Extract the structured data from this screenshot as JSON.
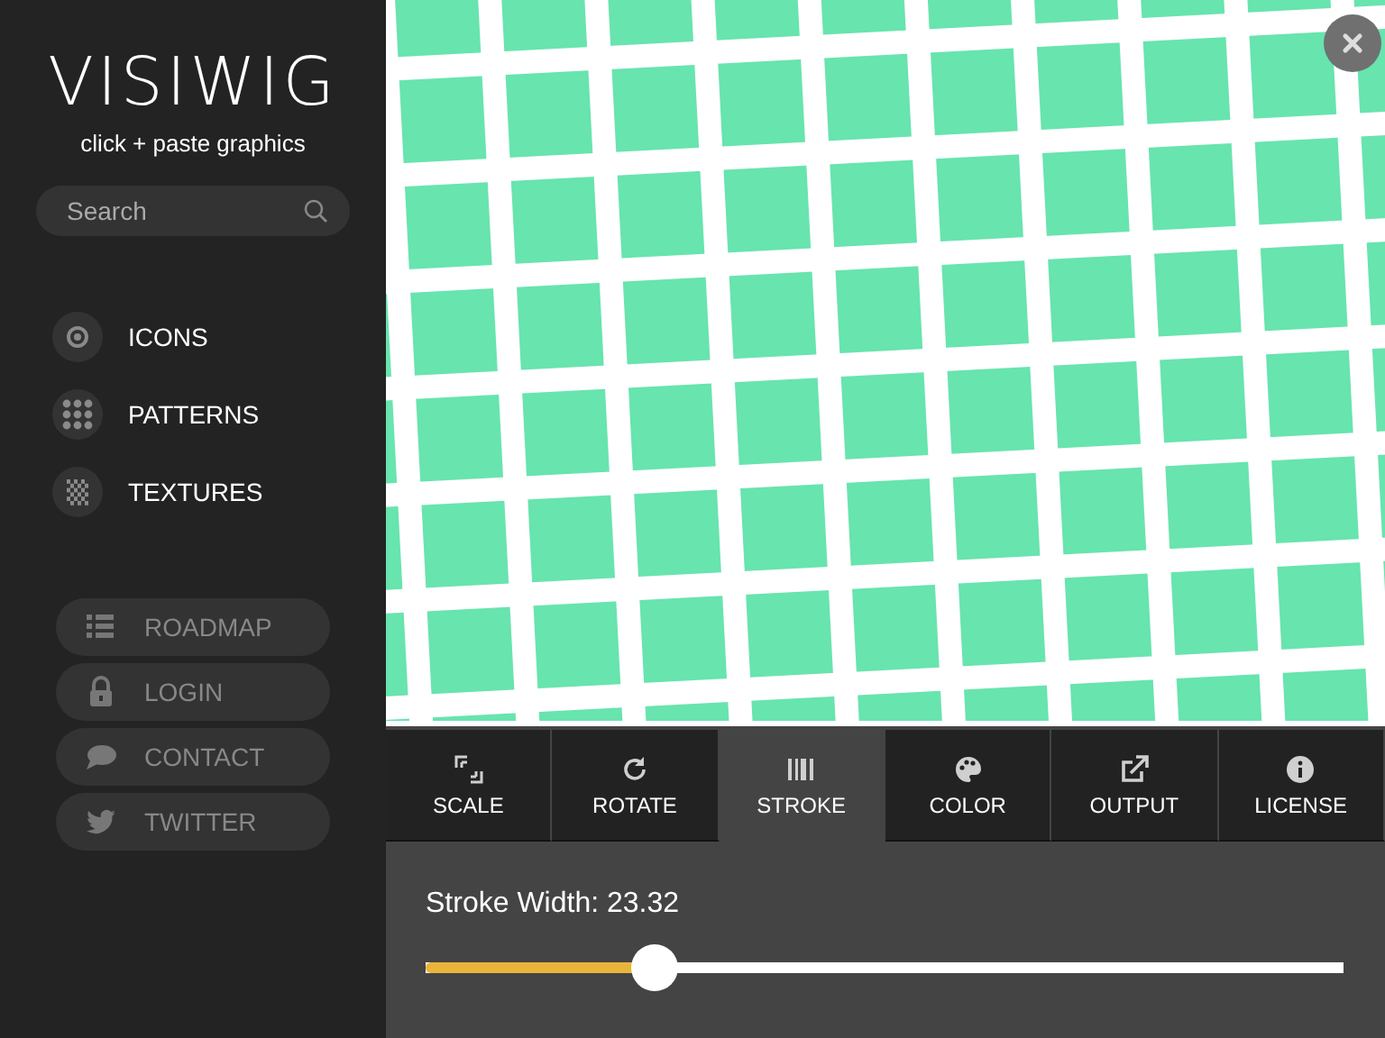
{
  "sidebar": {
    "logo": "VISIWIG",
    "tagline": "click + paste graphics",
    "search": {
      "placeholder": "Search"
    },
    "categories": [
      {
        "label": "ICONS",
        "kind": "icons"
      },
      {
        "label": "PATTERNS",
        "kind": "patterns"
      },
      {
        "label": "TEXTURES",
        "kind": "textures"
      }
    ],
    "links": [
      {
        "label": "ROADMAP",
        "kind": "roadmap"
      },
      {
        "label": "LOGIN",
        "kind": "login"
      },
      {
        "label": "CONTACT",
        "kind": "contact"
      },
      {
        "label": "TWITTER",
        "kind": "twitter"
      }
    ]
  },
  "tabs": [
    {
      "label": "SCALE",
      "kind": "scale",
      "selected": false
    },
    {
      "label": "ROTATE",
      "kind": "rotate",
      "selected": false
    },
    {
      "label": "STROKE",
      "kind": "stroke",
      "selected": true
    },
    {
      "label": "COLOR",
      "kind": "color",
      "selected": false
    },
    {
      "label": "OUTPUT",
      "kind": "output",
      "selected": false
    },
    {
      "label": "LICENSE",
      "kind": "license",
      "selected": false
    }
  ],
  "panel": {
    "label": "Stroke Width: 23.32",
    "slider": {
      "level": 0.25
    }
  }
}
